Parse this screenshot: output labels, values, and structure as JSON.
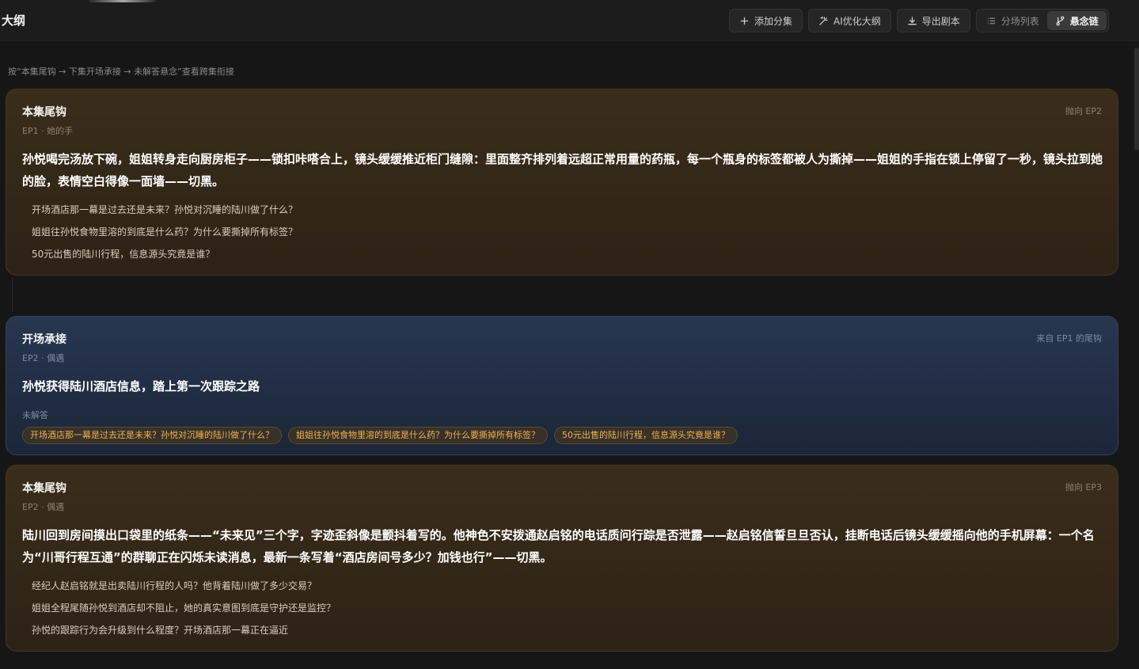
{
  "header": {
    "title": "大纲",
    "buttons": {
      "add_episode": "添加分集",
      "ai_optimize": "AI优化大纲",
      "export_script": "导出剧本"
    },
    "view_tabs": {
      "scene_list": "分场列表",
      "suspense_chain": "悬念链"
    }
  },
  "hint": "按“本集尾钩 → 下集开场承接 → 未解答悬念”查看跨集衔接",
  "cards": [
    {
      "type": "hook",
      "title": "本集尾钩",
      "subtitle": "EP1 · 她的手",
      "tag": "抛向 EP2",
      "body": "孙悦喝完汤放下碗，姐姐转身走向厨房柜子——锁扣咔嗒合上，镜头缓缓推近柜门缝隙：里面整齐排列着远超正常用量的药瓶，每一个瓶身的标签都被人为撕掉——姐姐的手指在锁上停留了一秒，镜头拉到她的脸，表情空白得像一面墙——切黑。",
      "questions": [
        "开场酒店那一幕是过去还是未来？孙悦对沉睡的陆川做了什么？",
        "姐姐往孙悦食物里溶的到底是什么药？为什么要撕掉所有标签？",
        "50元出售的陆川行程，信息源头究竟是谁？"
      ]
    },
    {
      "type": "opening",
      "title": "开场承接",
      "subtitle": "EP2 · 偶遇",
      "tag": "来自 EP1 的尾钩",
      "body": "孙悦获得陆川酒店信息，踏上第一次跟踪之路",
      "unanswered_label": "未解答",
      "unanswered": [
        "开场酒店那一幕是过去还是未来？孙悦对沉睡的陆川做了什么？",
        "姐姐往孙悦食物里溶的到底是什么药？为什么要撕掉所有标签？",
        "50元出售的陆川行程，信息源头究竟是谁？"
      ]
    },
    {
      "type": "hook",
      "title": "本集尾钩",
      "subtitle": "EP2 · 偶遇",
      "tag": "抛向 EP3",
      "body": "陆川回到房间摸出口袋里的纸条——“未来见”三个字，字迹歪斜像是颤抖着写的。他神色不安拨通赵启铭的电话质问行踪是否泄露——赵启铭信誓旦旦否认，挂断电话后镜头缓缓摇向他的手机屏幕：一个名为“川哥行程互通”的群聊正在闪烁未读消息，最新一条写着“酒店房间号多少？加钱也行”——切黑。",
      "questions": [
        "经纪人赵启铭就是出卖陆川行程的人吗？他背着陆川做了多少交易？",
        "姐姐全程尾随孙悦到酒店却不阻止，她的真实意图到底是守护还是监控？",
        "孙悦的跟踪行为会升级到什么程度？开场酒店那一幕正在逼近"
      ]
    }
  ]
}
